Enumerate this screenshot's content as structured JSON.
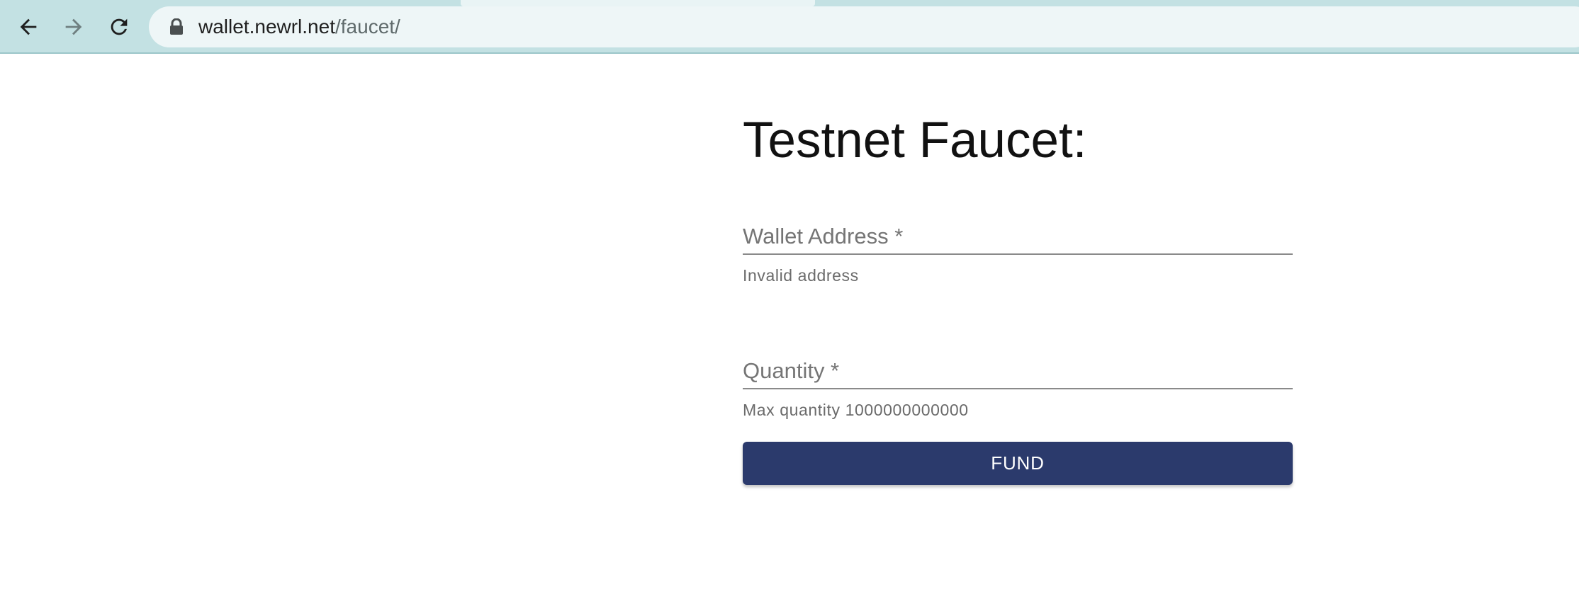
{
  "browser": {
    "url_host": "wallet.newrl.net",
    "url_path": "/faucet/",
    "colors": {
      "chrome": "#c3e1e3",
      "omnibox": "#eef6f7"
    },
    "icons": {
      "back": "arrow-left-icon",
      "forward": "arrow-right-icon",
      "reload": "reload-icon",
      "lock": "lock-icon"
    }
  },
  "page": {
    "title": "Testnet Faucet:",
    "wallet_field": {
      "label": "Wallet Address *",
      "value": "",
      "helper": "Invalid address"
    },
    "quantity_field": {
      "label": "Quantity *",
      "value": "",
      "helper": "Max quantity 1000000000000"
    },
    "fund_button": {
      "label": "FUND",
      "color": "#2b3a6c"
    }
  }
}
